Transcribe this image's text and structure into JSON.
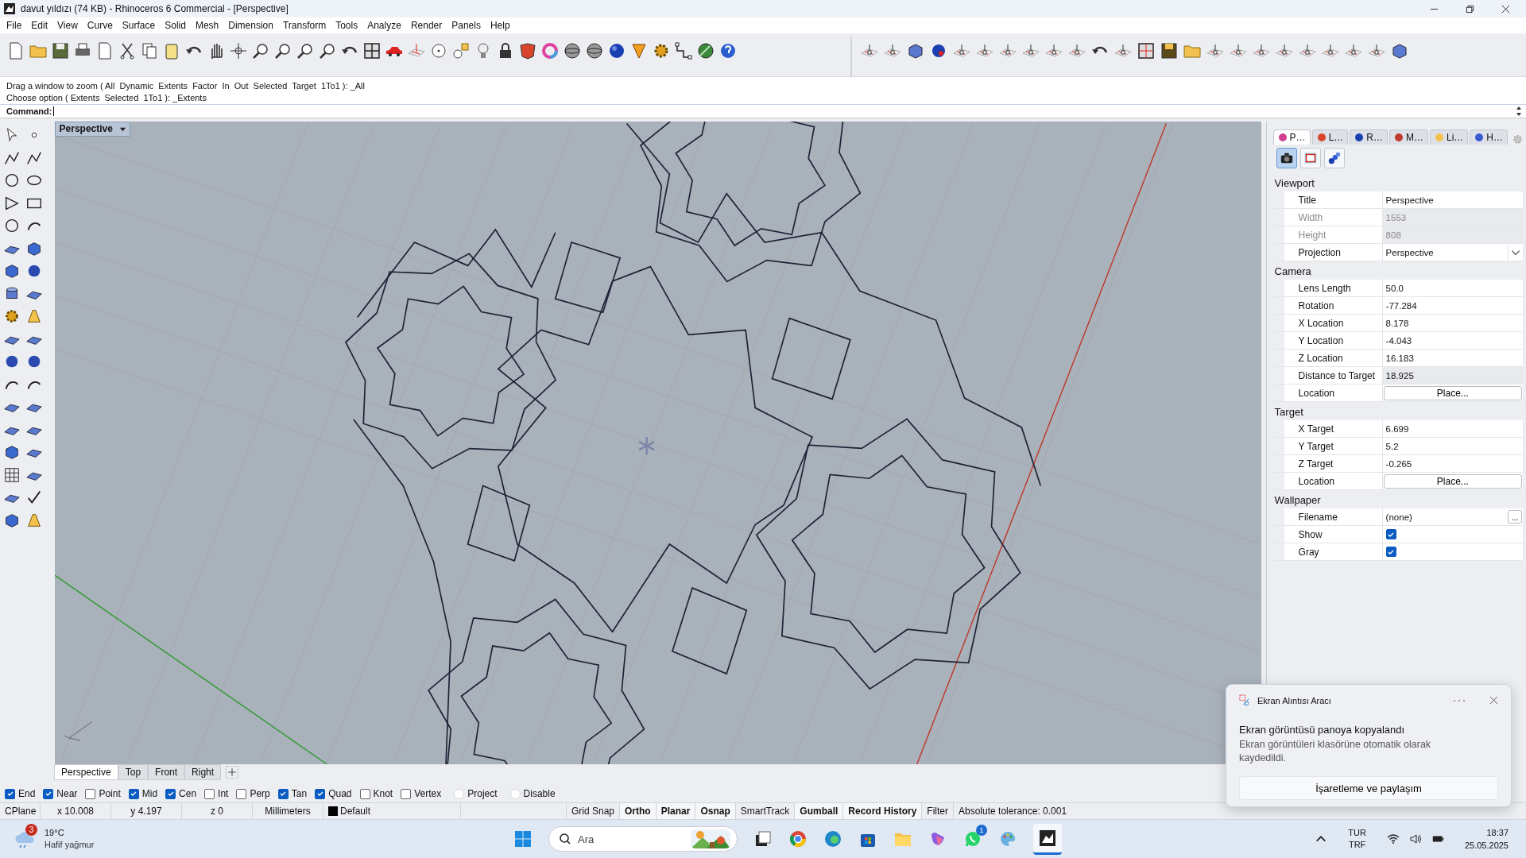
{
  "window": {
    "title": "davut yıldızı (74 KB) - Rhinoceros 6 Commercial - [Perspective]"
  },
  "menu": [
    "File",
    "Edit",
    "View",
    "Curve",
    "Surface",
    "Solid",
    "Mesh",
    "Dimension",
    "Transform",
    "Tools",
    "Analyze",
    "Render",
    "Panels",
    "Help"
  ],
  "command": {
    "history": [
      "Drag a window to zoom ( All  Dynamic  Extents  Factor  In  Out  Selected  Target  1To1 ): _All",
      "Choose option ( Extents  Selected  1To1 ): _Extents"
    ],
    "label": "Command:"
  },
  "viewport": {
    "title": "Perspective"
  },
  "viewport_tabs": [
    {
      "label": "Perspective",
      "selected": true
    },
    {
      "label": "Top",
      "selected": false
    },
    {
      "label": "Front",
      "selected": false
    },
    {
      "label": "Right",
      "selected": false
    }
  ],
  "properties": {
    "tabs": [
      {
        "label": "P…",
        "selected": true
      },
      {
        "label": "L…",
        "selected": false
      },
      {
        "label": "R…",
        "selected": false
      },
      {
        "label": "M…",
        "selected": false
      },
      {
        "label": "Li…",
        "selected": false
      },
      {
        "label": "H…",
        "selected": false
      }
    ],
    "views": [
      {
        "selected": true
      },
      {
        "selected": false
      },
      {
        "selected": false
      }
    ],
    "sections": [
      {
        "title": "Viewport",
        "rows": [
          {
            "label": "Title",
            "value": "Perspective",
            "kind": "text",
            "disabled": false
          },
          {
            "label": "Width",
            "value": "1553",
            "kind": "readonly",
            "disabled": true
          },
          {
            "label": "Height",
            "value": "808",
            "kind": "readonly",
            "disabled": true
          },
          {
            "label": "Projection",
            "value": "Perspective",
            "kind": "dropdown",
            "disabled": false
          }
        ]
      },
      {
        "title": "Camera",
        "rows": [
          {
            "label": "Lens Length",
            "value": "50.0",
            "kind": "text",
            "disabled": false
          },
          {
            "label": "Rotation",
            "value": "-77.284",
            "kind": "text",
            "disabled": false
          },
          {
            "label": "X Location",
            "value": "8.178",
            "kind": "text",
            "disabled": false
          },
          {
            "label": "Y Location",
            "value": "-4.043",
            "kind": "text",
            "disabled": false
          },
          {
            "label": "Z Location",
            "value": "16.183",
            "kind": "text",
            "disabled": false
          },
          {
            "label": "Distance to Target",
            "value": "18.925",
            "kind": "readonly",
            "disabled": false
          },
          {
            "label": "Location",
            "value": "Place...",
            "kind": "button",
            "disabled": false
          }
        ]
      },
      {
        "title": "Target",
        "rows": [
          {
            "label": "X Target",
            "value": "6.699",
            "kind": "text",
            "disabled": false
          },
          {
            "label": "Y Target",
            "value": "5.2",
            "kind": "text",
            "disabled": false
          },
          {
            "label": "Z Target",
            "value": "-0.265",
            "kind": "text",
            "disabled": false
          },
          {
            "label": "Location",
            "value": "Place...",
            "kind": "button",
            "disabled": false
          }
        ]
      },
      {
        "title": "Wallpaper",
        "rows": [
          {
            "label": "Filename",
            "value": "(none)",
            "browse": "...",
            "kind": "file",
            "disabled": false
          },
          {
            "label": "Show",
            "checked": true,
            "kind": "checkbox",
            "disabled": false
          },
          {
            "label": "Gray",
            "checked": true,
            "kind": "checkbox",
            "disabled": false
          }
        ]
      }
    ]
  },
  "osnaps": [
    {
      "label": "End",
      "checked": true,
      "kind": "check"
    },
    {
      "label": "Near",
      "checked": true,
      "kind": "check"
    },
    {
      "label": "Point",
      "checked": false,
      "kind": "check"
    },
    {
      "label": "Mid",
      "checked": true,
      "kind": "check"
    },
    {
      "label": "Cen",
      "checked": true,
      "kind": "check"
    },
    {
      "label": "Int",
      "checked": false,
      "kind": "check"
    },
    {
      "label": "Perp",
      "checked": false,
      "kind": "check"
    },
    {
      "label": "Tan",
      "checked": true,
      "kind": "check"
    },
    {
      "label": "Quad",
      "checked": true,
      "kind": "check"
    },
    {
      "label": "Knot",
      "checked": false,
      "kind": "check"
    },
    {
      "label": "Vertex",
      "checked": false,
      "kind": "check"
    },
    {
      "label": "Project",
      "checked": false,
      "kind": "option"
    },
    {
      "label": "Disable",
      "checked": false,
      "kind": "option"
    }
  ],
  "status_bar": {
    "cplane": "CPlane",
    "x": "x 10.008",
    "y": "y 4.197",
    "z": "z 0",
    "units": "Millimeters",
    "layer": {
      "name": "Default",
      "color": "#000000"
    },
    "toggles": [
      {
        "label": "Grid Snap",
        "on": false
      },
      {
        "label": "Ortho",
        "on": true
      },
      {
        "label": "Planar",
        "on": true
      },
      {
        "label": "Osnap",
        "on": true
      },
      {
        "label": "SmartTrack",
        "on": false
      },
      {
        "label": "Gumball",
        "on": true
      },
      {
        "label": "Record History",
        "on": true
      },
      {
        "label": "Filter",
        "on": false
      }
    ],
    "tolerance": "Absolute tolerance: 0.001"
  },
  "toast": {
    "app": "Ekran Alıntısı Aracı",
    "heading": "Ekran görüntüsü panoya kopyalandı",
    "body": "Ekran görüntüleri klasörüne otomatik olarak kaydedildi.",
    "button": "İşaretleme ve paylaşım"
  },
  "taskbar": {
    "weather": {
      "badge": "3",
      "temperature": "19°C",
      "condition": "Hafif yağmur"
    },
    "search": {
      "placeholder": "Ara"
    },
    "chat_badge": "1",
    "language": "TUR",
    "layout": "TRF",
    "time": "18:37",
    "date": "25.05.2025"
  }
}
